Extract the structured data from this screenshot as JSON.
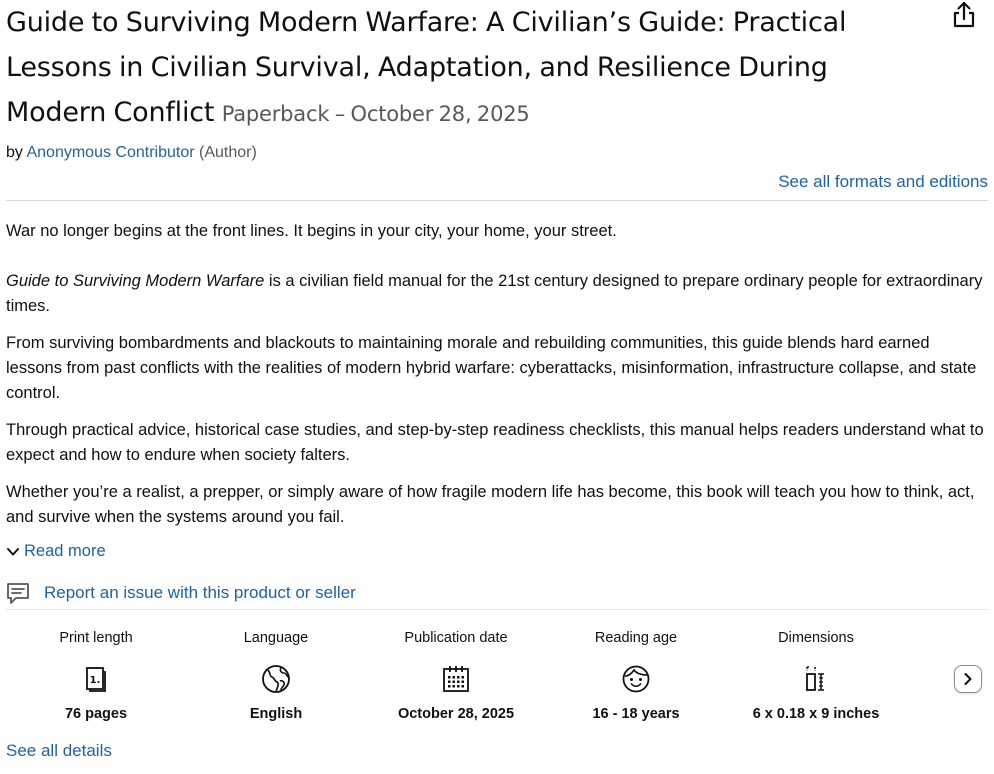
{
  "product": {
    "title": "Guide to Surviving Modern Warfare: A Civilian’s Guide: Practical Lessons in Civilian Survival, Adaptation, and Resilience During Modern Conflict",
    "format": "Paperback – October 28, 2025"
  },
  "byline": {
    "prefix": "by",
    "author": "Anonymous Contributor",
    "role": "(Author)"
  },
  "formats_link": "See all formats and editions",
  "description": {
    "p1": "War no longer begins at the front lines. It begins in your city, your home, your street.",
    "p2_italic": "Guide to Surviving Modern Warfare",
    "p2_rest": " is a civilian field manual for the 21st century designed to prepare ordinary people for extraordinary times.",
    "p3": "From surviving bombardments and blackouts to maintaining morale and rebuilding communities, this guide blends hard earned lessons from past conflicts with the realities of modern hybrid warfare: cyberattacks, misinformation, infrastructure collapse, and state control.",
    "p4": "Through practical advice, historical case studies, and step-by-step readiness checklists, this manual helps readers understand what to expect and how to endure when society falters.",
    "p5": "Whether you’re a realist, a prepper, or simply aware of how fragile modern life has become, this book will teach you how to think, act, and survive when the systems around you fail."
  },
  "read_more": "Read more",
  "report_link": "Report an issue with this product or seller",
  "details": [
    {
      "label": "Print length",
      "icon": "book-pages-icon",
      "value": "76 pages"
    },
    {
      "label": "Language",
      "icon": "globe-icon",
      "value": "English"
    },
    {
      "label": "Publication date",
      "icon": "calendar-icon",
      "value": "October 28, 2025"
    },
    {
      "label": "Reading age",
      "icon": "child-face-icon",
      "value": "16 - 18 years"
    },
    {
      "label": "Dimensions",
      "icon": "dimensions-icon",
      "value": "6 x 0.18 x 9 inches"
    }
  ],
  "see_all_details": "See all details",
  "colors": {
    "link": "#2162a1",
    "text": "#0f1111",
    "muted": "#565959",
    "divider": "#d5d9d9"
  }
}
